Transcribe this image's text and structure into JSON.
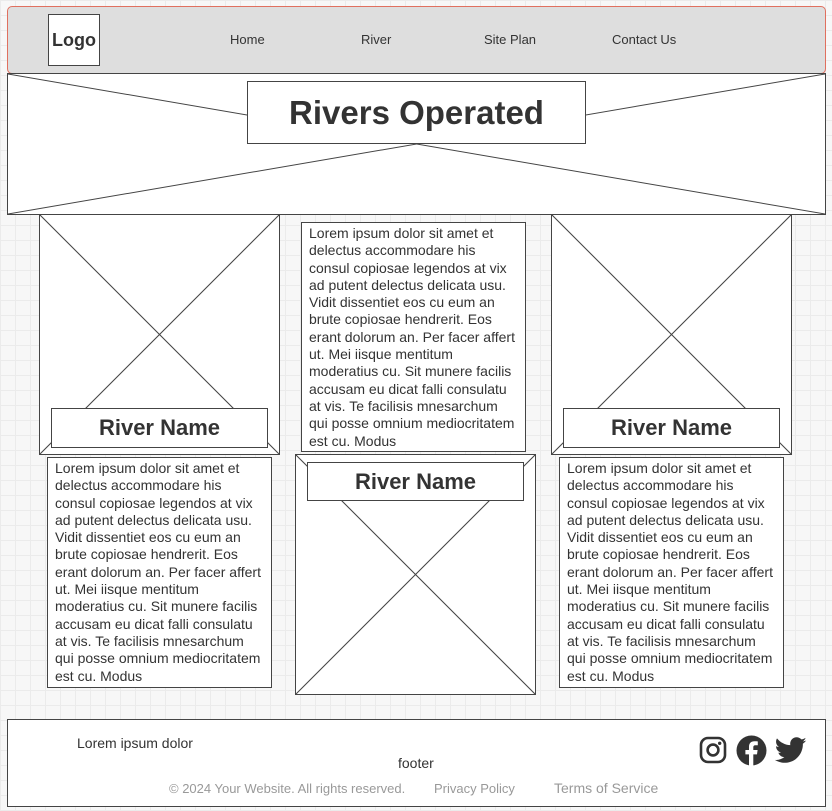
{
  "header": {
    "logo": "Logo",
    "nav": [
      "Home",
      "River",
      "Site Plan",
      "Contact Us"
    ]
  },
  "hero": {
    "title": "Rivers Operated"
  },
  "lorem": "Lorem ipsum dolor sit amet et delectus accommodare his consul copiosae legendos at vix ad putent delectus delicata usu. Vidit dissentiet eos cu eum an brute copiosae hendrerit. Eos erant dolorum an. Per facer affert ut. Mei iisque mentitum moderatius cu. Sit munere facilis accusam eu dicat falli consulatu at vis. Te facilisis mnesarchum qui posse omnium mediocritatem est cu. Modus",
  "cards": [
    {
      "name": "River Name"
    },
    {
      "name": "River Name"
    },
    {
      "name": "River Name"
    }
  ],
  "footer": {
    "tagline": "Lorem ipsum dolor",
    "label": "footer",
    "copyright": "© 2024 Your Website. All rights reserved.",
    "privacy": "Privacy Policy",
    "terms": "Terms of Service",
    "social_icons": [
      "instagram-icon",
      "facebook-icon",
      "twitter-icon"
    ]
  },
  "colors": {
    "header_border": "#e0705f",
    "header_bg": "#dedede",
    "grid": "#ebebeb"
  }
}
